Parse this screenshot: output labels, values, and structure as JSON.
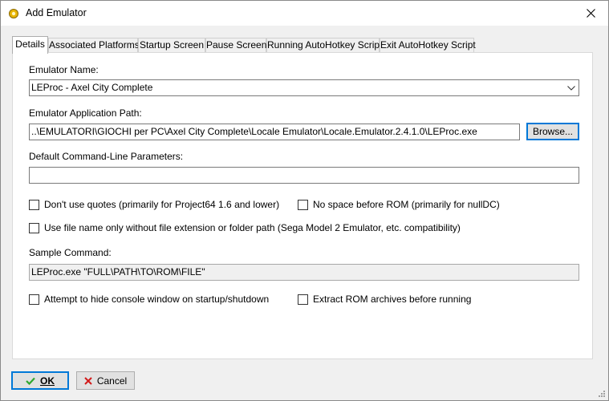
{
  "window": {
    "title": "Add Emulator"
  },
  "tabs": [
    {
      "label": "Details",
      "active": true
    },
    {
      "label": "Associated Platforms"
    },
    {
      "label": "Startup Screen"
    },
    {
      "label": "Pause Screen"
    },
    {
      "label": "Running AutoHotkey Script"
    },
    {
      "label": "Exit AutoHotkey Script"
    }
  ],
  "details": {
    "emulator_name_label": "Emulator Name:",
    "emulator_name_value": "LEProc - Axel City Complete",
    "app_path_label": "Emulator Application Path:",
    "app_path_value": "..\\EMULATORI\\GIOCHI per PC\\Axel City Complete\\Locale Emulator\\Locale.Emulator.2.4.1.0\\LEProc.exe",
    "browse_label": "Browse...",
    "cmdline_label": "Default Command-Line Parameters:",
    "cmdline_value": "",
    "no_quotes_label": "Don't use quotes (primarily for Project64 1.6 and lower)",
    "no_space_label": "No space before ROM (primarily for nullDC)",
    "filename_only_label": "Use file name only without file extension or folder path (Sega Model 2 Emulator, etc. compatibility)",
    "sample_label": "Sample Command:",
    "sample_value": "LEProc.exe \"FULL\\PATH\\TO\\ROM\\FILE\"",
    "hide_console_label": "Attempt to hide console window on startup/shutdown",
    "extract_label": "Extract ROM archives before running"
  },
  "footer": {
    "ok_label": "OK",
    "cancel_label": "Cancel"
  },
  "colors": {
    "ok_check": "#2fa82f",
    "cancel_x": "#d21a1a",
    "focus": "#0078d7"
  }
}
